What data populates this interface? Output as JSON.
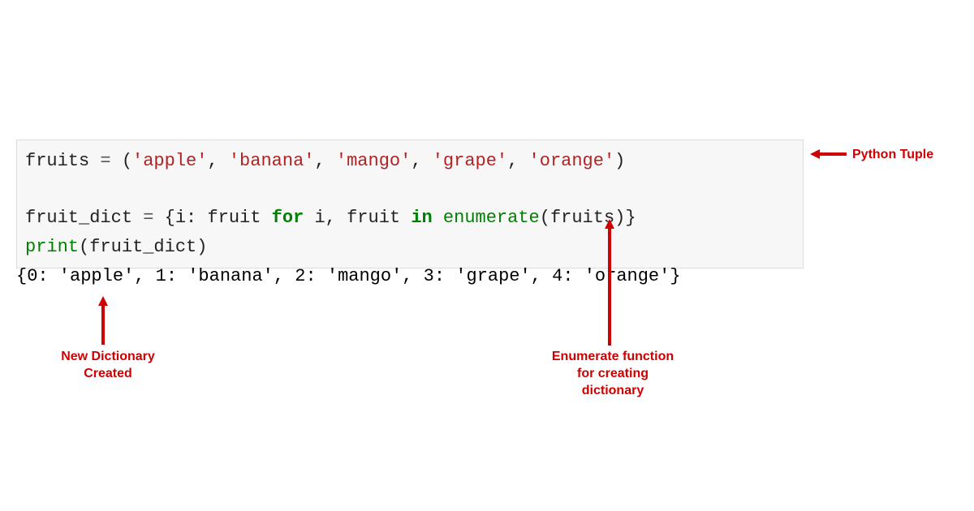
{
  "code": {
    "line1_var": "fruits",
    "line1_eq": " = ",
    "line1_open": "(",
    "line1_s1": "'apple'",
    "line1_c1": ", ",
    "line1_s2": "'banana'",
    "line1_c2": ", ",
    "line1_s3": "'mango'",
    "line1_c3": ", ",
    "line1_s4": "'grape'",
    "line1_c4": ", ",
    "line1_s5": "'orange'",
    "line1_close": ")",
    "line3_var": "fruit_dict",
    "line3_eq": " = ",
    "line3_open": "{i: fruit ",
    "line3_for": "for",
    "line3_mid": " i, fruit ",
    "line3_in": "in",
    "line3_sp": " ",
    "line3_enum": "enumerate",
    "line3_end": "(fruits)}",
    "line4_print": "print",
    "line4_args": "(fruit_dict)"
  },
  "output": "{0: 'apple', 1: 'banana', 2: 'mango', 3: 'grape', 4: 'orange'}",
  "annotations": {
    "tuple": "Python Tuple",
    "dict_created_l1": "New Dictionary",
    "dict_created_l2": "Created",
    "enum_l1": "Enumerate function",
    "enum_l2": "for creating",
    "enum_l3": "dictionary"
  }
}
